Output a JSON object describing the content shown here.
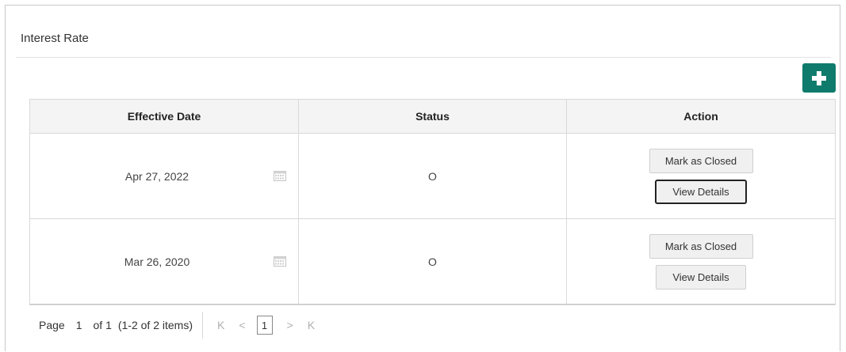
{
  "panel": {
    "title": "Interest Rate",
    "add_icon": "plus-icon",
    "accent_color": "#0f7b6c"
  },
  "table": {
    "columns": [
      "Effective Date",
      "Status",
      "Action"
    ],
    "rows": [
      {
        "effective_date": "Apr 27, 2022",
        "status": "O",
        "action_close": "Mark as Closed",
        "action_view": "View Details"
      },
      {
        "effective_date": "Mar 26, 2020",
        "status": "O",
        "action_close": "Mark as Closed",
        "action_view": "View Details"
      }
    ]
  },
  "pagination": {
    "page_label": "Page",
    "current_page": "1",
    "of_label": "of 1",
    "items_summary": "(1-2 of 2 items)",
    "page_button": "1",
    "first_icon": "K",
    "prev_icon": "<",
    "next_icon": ">",
    "last_icon": "K"
  }
}
